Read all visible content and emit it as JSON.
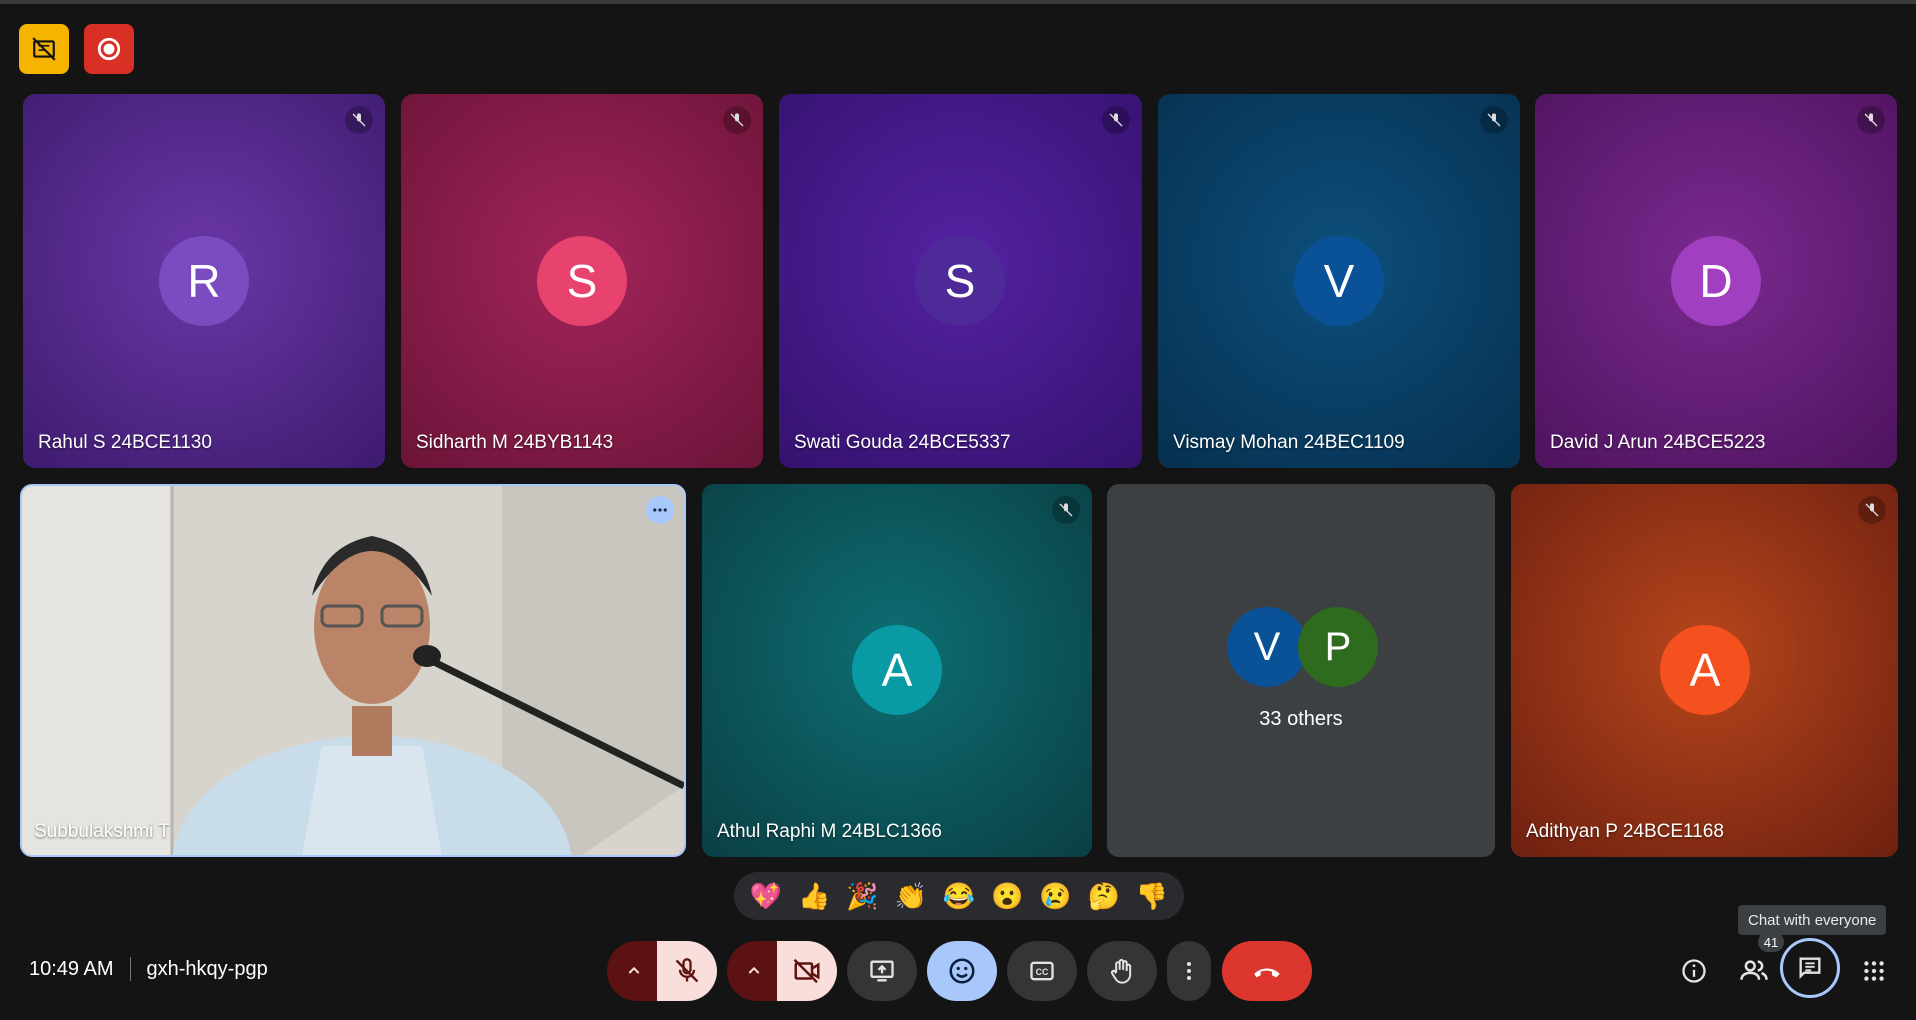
{
  "top": {
    "icons": [
      "no-video-sharing-icon",
      "recording-icon"
    ]
  },
  "tiles_row1": [
    {
      "name": "Rahul S 24BCE1130",
      "initial": "R",
      "bg": "#5e2b96",
      "avatar": "#6f42b9"
    },
    {
      "name": "Sidharth M 24BYB1143",
      "initial": "S",
      "bg": "#8c1d48",
      "avatar": "#e8426f"
    },
    {
      "name": "Swati Gouda 24BCE5337",
      "initial": "S",
      "bg": "#451a8a",
      "avatar": "#4e2a99"
    },
    {
      "name": "Vismay Mohan 24BEC1109",
      "initial": "V",
      "bg": "#0a3c63",
      "avatar": "#0a5298"
    },
    {
      "name": "David J Arun 24BCE5223",
      "initial": "D",
      "bg": "#6a1d78",
      "avatar": "#a040c0"
    }
  ],
  "tiles_row2": [
    {
      "name": "Subbulakshmi T",
      "type": "video"
    },
    {
      "name": "Athul Raphi M 24BLC1366",
      "initial": "A",
      "bg": "#0b5a5e",
      "avatar": "#0a9aa4"
    },
    {
      "name": "33 others",
      "initials": [
        "V",
        "P"
      ],
      "bg": "#3c4043"
    },
    {
      "name": "Adithyan P 24BCE1168",
      "initial": "A",
      "bg": "#a13a17",
      "avatar": "#f4511e"
    }
  ],
  "reactions": [
    "💖",
    "👍",
    "🎉",
    "👏",
    "😂",
    "😮",
    "😢",
    "🤔",
    "👎"
  ],
  "footer": {
    "time": "10:49 AM",
    "meeting_code": "gxh-hkqy-pgp"
  },
  "tooltip": "Chat with everyone",
  "participants_count": "41",
  "colors": {
    "end_call": "#ea4335",
    "mic_off_bg": "#f9dedc",
    "active": "#a8c7fa"
  }
}
